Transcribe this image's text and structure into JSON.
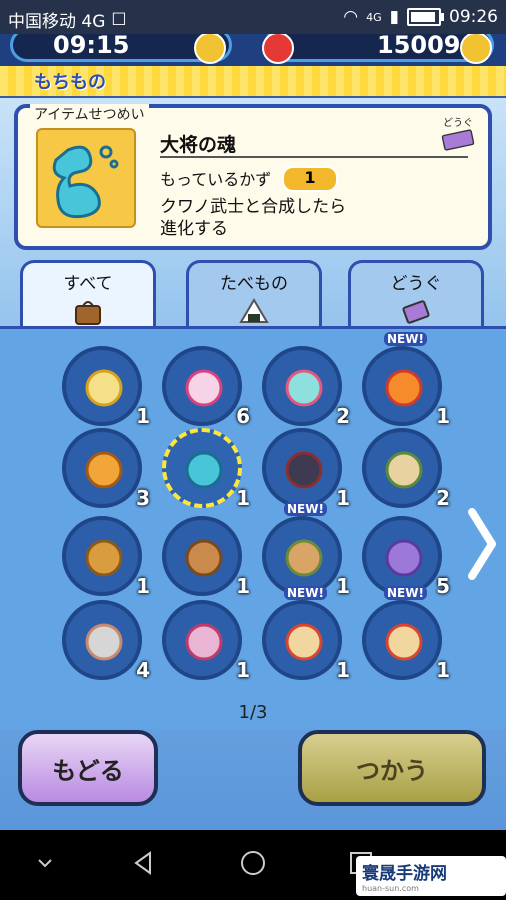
{
  "status_bar": {
    "carrier": "中国移动 4G",
    "time": "09:26",
    "signal_label": "4G"
  },
  "top_bar": {
    "counter1": "09:15",
    "counter2": "15009"
  },
  "header": {
    "title": "もちもの"
  },
  "detail": {
    "section_label": "アイテムせつめい",
    "category_label": "どうぐ",
    "name": "大将の魂",
    "count_label": "もっているかず",
    "count": "1",
    "desc_line1": "クワノ武士と合成したら",
    "desc_line2": "進化する"
  },
  "tabs": [
    {
      "label": "すべて",
      "icon": "bag-icon"
    },
    {
      "label": "たべもの",
      "icon": "rice-ball-icon"
    },
    {
      "label": "どうぐ",
      "icon": "ticket-icon"
    }
  ],
  "grid": {
    "items": [
      {
        "count": "1",
        "icon": "small-orb-yellow",
        "new": false
      },
      {
        "count": "6",
        "icon": "small-orb-pink",
        "new": false
      },
      {
        "count": "2",
        "icon": "swirl-orb-teal",
        "new": false
      },
      {
        "count": "1",
        "icon": "swirl-orb-orange",
        "new": true
      },
      {
        "count": "3",
        "icon": "book-icon",
        "new": false
      },
      {
        "count": "1",
        "icon": "spirit-soul-icon",
        "new": false,
        "selected": true
      },
      {
        "count": "1",
        "icon": "armor-figure-icon",
        "new": false
      },
      {
        "count": "2",
        "icon": "sandwich-icon",
        "new": false
      },
      {
        "count": "1",
        "icon": "croissant-icon",
        "new": false
      },
      {
        "count": "1",
        "icon": "bread-icon",
        "new": false
      },
      {
        "count": "1",
        "icon": "burger-icon",
        "new": true
      },
      {
        "count": "5",
        "icon": "candy-icon",
        "new": false
      },
      {
        "count": "4",
        "icon": "shrimp-plate-icon",
        "new": false
      },
      {
        "count": "1",
        "icon": "shaved-ice-icon",
        "new": false
      },
      {
        "count": "1",
        "icon": "milk-bottle-icon",
        "new": true
      },
      {
        "count": "1",
        "icon": "milk-bottle-icon",
        "new": true
      }
    ],
    "new_label": "NEW!"
  },
  "pagination": "1/3",
  "buttons": {
    "back": "もどる",
    "use": "つかう"
  },
  "watermark": {
    "title": "寰晟手游网",
    "url": "huan-sun.com"
  }
}
